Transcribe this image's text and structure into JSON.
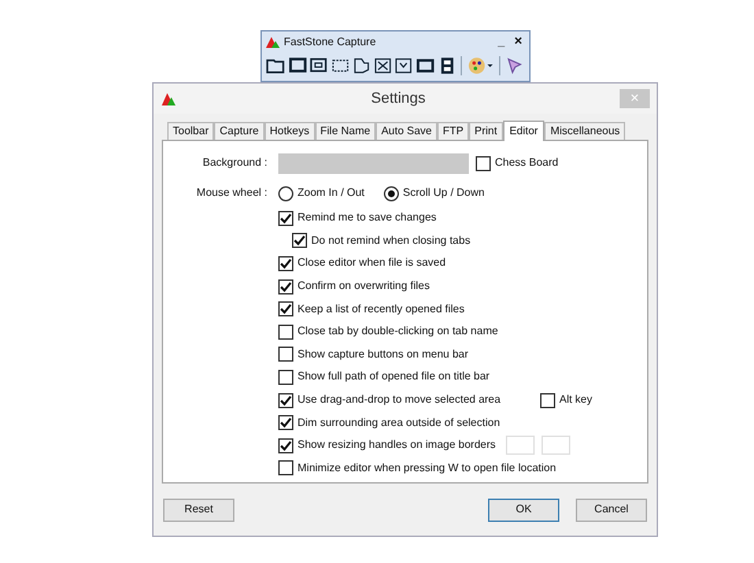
{
  "toolbar_window": {
    "title": "FastStone Capture",
    "minimize": "_",
    "close": "×"
  },
  "dialog": {
    "title": "Settings",
    "close": "×",
    "tabs": [
      {
        "label": "Toolbar",
        "selected": false
      },
      {
        "label": "Capture",
        "selected": false
      },
      {
        "label": "Hotkeys",
        "selected": false
      },
      {
        "label": "File Name",
        "selected": false
      },
      {
        "label": "Auto Save",
        "selected": false
      },
      {
        "label": "FTP",
        "selected": false
      },
      {
        "label": "Print",
        "selected": false
      },
      {
        "label": "Editor",
        "selected": true
      },
      {
        "label": "Miscellaneous",
        "selected": false
      }
    ],
    "background": {
      "label": "Background :",
      "chess_board": {
        "label": "Chess Board",
        "checked": false
      }
    },
    "mouse_wheel": {
      "label": "Mouse wheel :",
      "options": [
        {
          "label": "Zoom In / Out",
          "selected": false
        },
        {
          "label": "Scroll Up / Down",
          "selected": true
        }
      ]
    },
    "options": [
      {
        "kind": "check",
        "label": "Remind me to save changes",
        "checked": true,
        "children": [
          {
            "kind": "check",
            "label": "Do not remind when closing tabs",
            "checked": true
          }
        ]
      },
      {
        "kind": "check",
        "label": "Close editor when file is saved",
        "checked": true
      },
      {
        "kind": "check",
        "label": "Confirm on overwriting files",
        "checked": true
      },
      {
        "kind": "check",
        "label": "Keep a list of recently opened files",
        "checked": true
      },
      {
        "kind": "check",
        "label": "Close tab by double-clicking on tab name",
        "checked": false
      },
      {
        "kind": "check",
        "label": "Show capture buttons on menu bar",
        "checked": false
      },
      {
        "kind": "check",
        "label": "Show full path of opened file on title bar",
        "checked": false
      },
      {
        "kind": "check_with_option",
        "label": "Use drag-and-drop to move selected area",
        "checked": true,
        "option": {
          "label": "Alt key",
          "checked": false
        }
      },
      {
        "kind": "check",
        "label": "Dim surrounding area outside of selection",
        "checked": true
      },
      {
        "kind": "check_with_fields",
        "label": "Show resizing handles on image borders",
        "checked": true
      },
      {
        "kind": "check",
        "label": "Minimize editor when pressing W to open file location",
        "checked": false
      }
    ],
    "buttons": [
      {
        "label": "Reset",
        "default": false
      },
      {
        "label": "OK",
        "default": true
      },
      {
        "label": "Cancel",
        "default": false
      }
    ]
  }
}
